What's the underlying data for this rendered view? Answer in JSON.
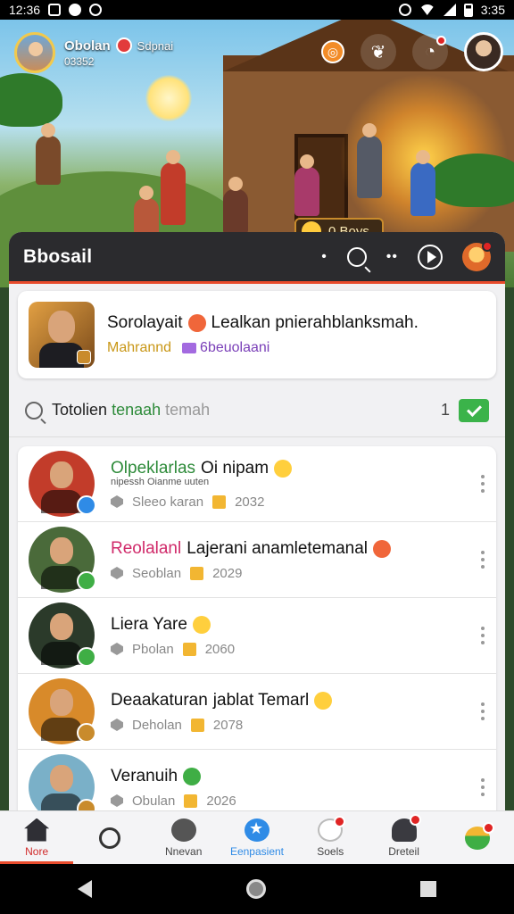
{
  "status_bar": {
    "time": "12:36",
    "right_time": "3:35"
  },
  "hero": {
    "profile_name": "Obolan",
    "profile_tag": "Sdpnai",
    "profile_id": "03352",
    "chip_label": "0.Boys",
    "icons": [
      "coin-icon",
      "leaf-icon",
      "message-icon"
    ]
  },
  "panel": {
    "title": "Bbosail",
    "dots": "• ••"
  },
  "featured": {
    "name": "Sorolayait",
    "headline": "Lealkan pnierahblanksmah.",
    "subtitle": "Mahrannd",
    "tag": "6beuolaani"
  },
  "search": {
    "prefix": "Totolien",
    "highlight": "tenaah",
    "placeholder": "temah",
    "count": "1"
  },
  "rows": [
    {
      "title": "Olpeklarlas",
      "title_extra": "Oi nipam",
      "subtitle": "nipessh Oianme uuten",
      "meta": "Sleeo karan",
      "year": "2032",
      "accent": "#2e8b3a",
      "badge": "#2f8be6",
      "avatar_bg": "#c23c2a"
    },
    {
      "title": "Reolalanl",
      "title_extra": "Lajerani anamletemanal",
      "subtitle": "",
      "meta": "Seoblan",
      "year": "2029",
      "accent": "#d02a6a",
      "badge": "#3fae45",
      "avatar_bg": "#4a6a3a"
    },
    {
      "title": "Liera Yare",
      "title_extra": "",
      "subtitle": "",
      "meta": "Pbolan",
      "year": "2060",
      "accent": "#111111",
      "badge": "#3fae45",
      "avatar_bg": "#2b3a2a"
    },
    {
      "title": "Deaakaturan",
      "title_extra": "jablat Temarl",
      "subtitle": "",
      "meta": "Deholan",
      "year": "2078",
      "accent": "#111111",
      "badge": "#c98b2c",
      "avatar_bg": "#d88a2a"
    },
    {
      "title": "Veranuih",
      "title_extra": "",
      "subtitle": "",
      "meta": "Obulan",
      "year": "2026",
      "accent": "#111111",
      "badge": "#c98b2c",
      "avatar_bg": "#7ab0c8"
    }
  ],
  "nav": [
    {
      "label": "Nore",
      "icon": "home-icon",
      "active": true,
      "dot": true
    },
    {
      "label": "",
      "icon": "search-icon",
      "active": false,
      "dot": false
    },
    {
      "label": "Nnevan",
      "icon": "chat-icon",
      "active": false,
      "dot": false
    },
    {
      "label": "Eenpasient",
      "icon": "star-icon",
      "active": false,
      "dot": false
    },
    {
      "label": "Soels",
      "icon": "bubble-icon",
      "active": false,
      "dot": true
    },
    {
      "label": "Dreteil",
      "icon": "person-icon",
      "active": false,
      "dot": true
    },
    {
      "label": "",
      "icon": "globe-icon",
      "active": false,
      "dot": true
    }
  ]
}
